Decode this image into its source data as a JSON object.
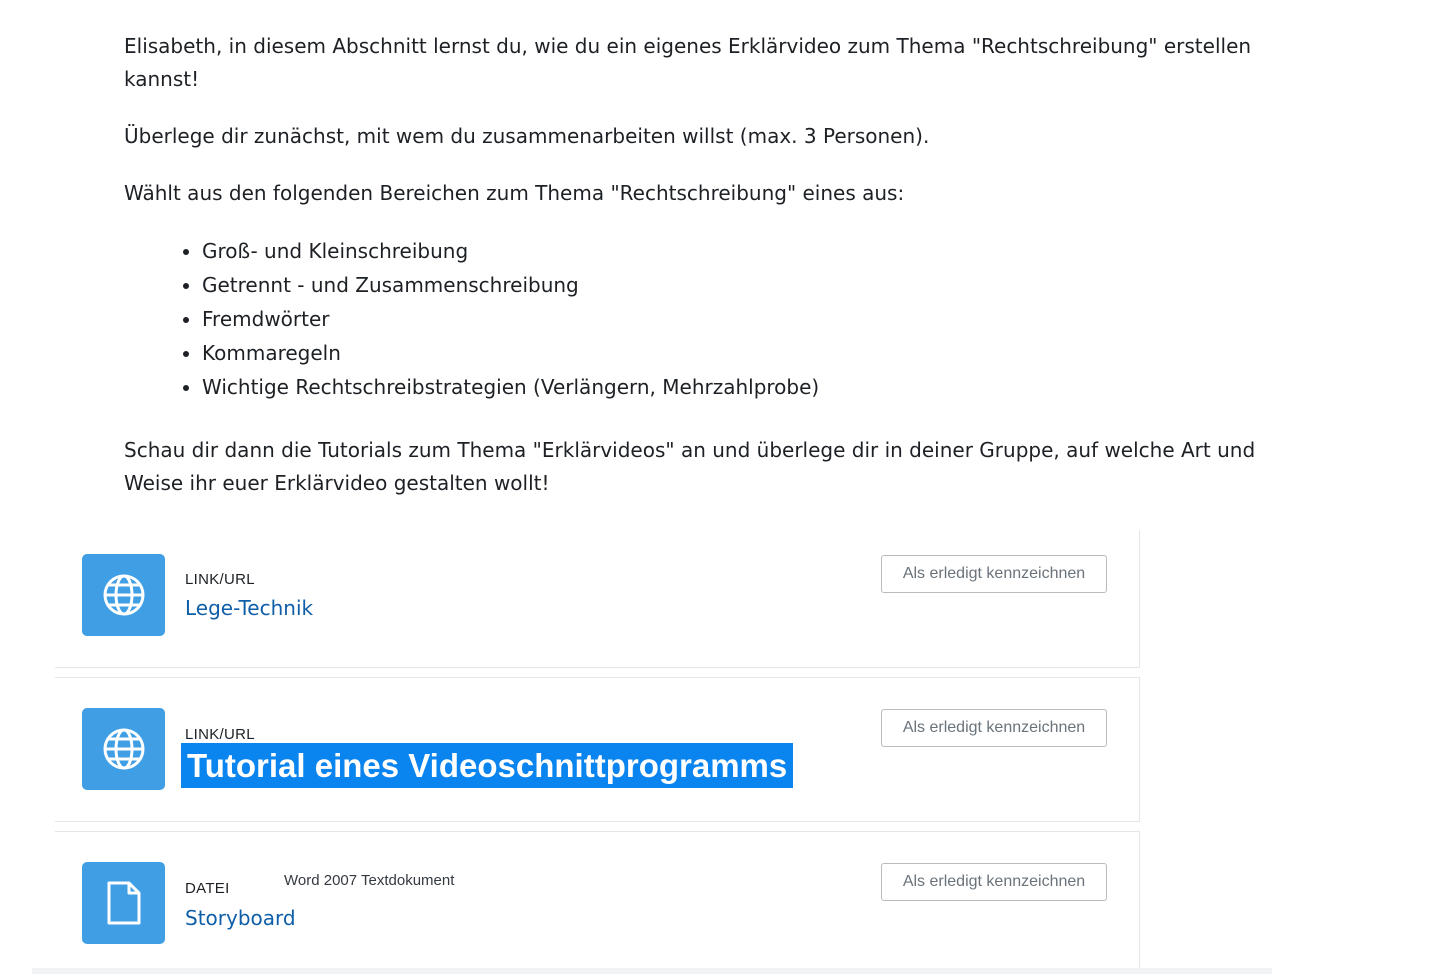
{
  "intro": {
    "paragraph1": "Elisabeth, in diesem Abschnitt lernst du, wie du ein eigenes Erklärvideo zum Thema \"Rechtschreibung\" erstellen kannst!",
    "paragraph2": "Überlege dir zunächst, mit wem du zusammenarbeiten willst (max. 3 Personen).",
    "paragraph3": "Wählt aus den folgenden Bereichen zum Thema \"Rechtschreibung\" eines aus:",
    "topics": [
      "Groß- und Kleinschreibung",
      "Getrennt - und Zusammenschreibung",
      "Fremdwörter",
      "Kommaregeln",
      "Wichtige Rechtschreibstrategien (Verlängern, Mehrzahlprobe)"
    ],
    "paragraph4": "Schau dir dann die Tutorials zum Thema \"Erklärvideos\" an und überlege dir in deiner Gruppe, auf welche Art und Weise ihr euer Erklärvideo gestalten wollt!"
  },
  "activities": [
    {
      "type": "LINK/URL",
      "title": "Lege-Technik",
      "icon": "globe-icon",
      "button": "Als erledigt kennzeichnen"
    },
    {
      "type": "LINK/URL",
      "title": "Tutorial eines Videoschnittprogramms",
      "icon": "globe-icon",
      "button": "Als erledigt kennzeichnen",
      "highlighted": true
    },
    {
      "type": "DATEI",
      "title": "Storyboard",
      "meta": "Word 2007 Textdokument",
      "icon": "file-icon",
      "button": "Als erledigt kennzeichnen"
    }
  ],
  "colors": {
    "icon_bg": "#3f9ee4",
    "link": "#0f5ea8",
    "selection": "#0a84ee",
    "button_text": "#6a737b"
  }
}
